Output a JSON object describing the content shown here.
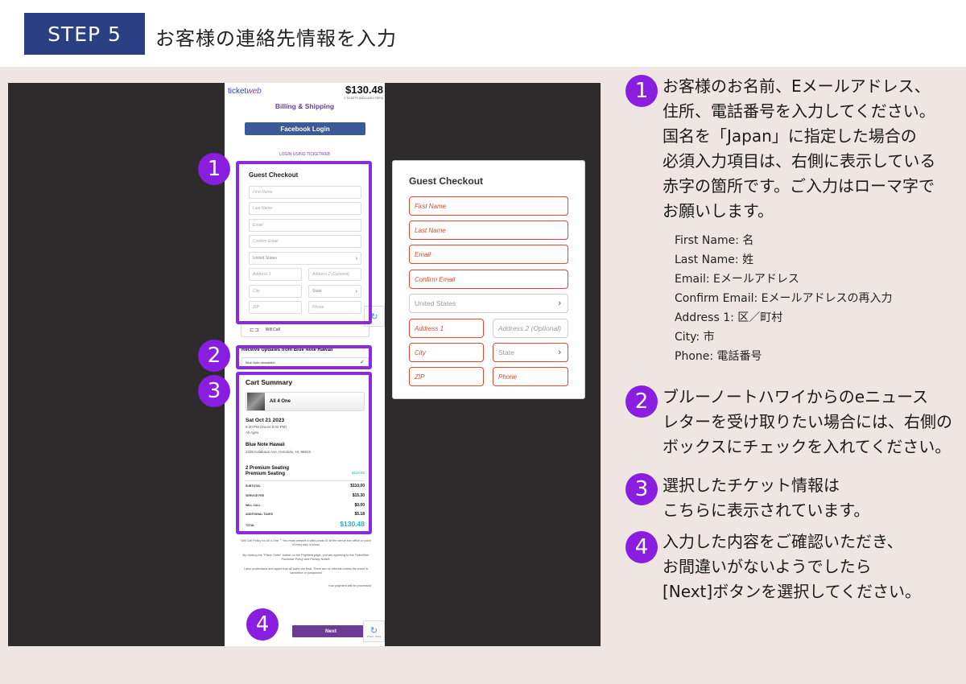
{
  "header": {
    "step": "STEP 5",
    "title": "お客様の連絡先情報を入力"
  },
  "phone": {
    "logo_a": "ticket",
    "logo_b": "web",
    "total": "$130.48",
    "total_sub": "2 TICKETS (INCLUDES FEES)",
    "billing_title": "Billing & Shipping",
    "facebook_label": "Facebook Login",
    "login_ticketweb": "LOGIN USING TICKETWEB",
    "guest_checkout": "Guest Checkout",
    "fields": {
      "first_name": "First Name",
      "last_name": "Last Name",
      "email": "Email",
      "confirm_email": "Confirm Email",
      "country": "United States",
      "address1": "Address 1",
      "address2": "Address 2 (Optional)",
      "city": "City",
      "state": "State",
      "zip": "ZIP",
      "phone": "Phone"
    },
    "will_call": "Will Call",
    "updates_title": "Receive Updates from Blue Note Hawaii",
    "newsletter": "Blue Note newsletter",
    "cart": {
      "title": "Cart Summary",
      "event": "All 4 One",
      "date": "Sat Oct 21 2023",
      "time": "6:30 PM (Doors 5:00 PM)",
      "ages": "All Ages",
      "venue": "Blue Note Hawaii",
      "address": "2335 Kalakaua Ave, Honolulu, HI, 96815",
      "seat_line1": "2 Premium Seating",
      "seat_line2": "Premium Seating",
      "seat_price": "$110.00",
      "rows": [
        {
          "k": "SUBTOTAL",
          "v": "$110.00"
        },
        {
          "k": "SERVICE FEE",
          "v": "$15.30"
        },
        {
          "k": "WILL CALL",
          "v": "$0.00"
        },
        {
          "k": "ADDITIONAL TAXES",
          "v": "$5.18"
        },
        {
          "k": "TOTAL",
          "v": "$130.48"
        }
      ]
    },
    "policy1": "Will Call Policy for All 4 One \"\" You must present a valid photo ID at the venue box office or point of entry day of show.",
    "policy2": "By clicking the \"Place Order\" button on the Payment page, you are agreeing to the TicketWeb Purchase Policy and Privacy Notice.",
    "policy3": "I also understand and agree that all sales are final. There are no refunds unless the event is cancelled or postponed",
    "policy4": "Your payment will be processed",
    "next": "Next",
    "recaptcha_text": "Privacy - Terms"
  },
  "callouts": [
    "1",
    "2",
    "3",
    "4"
  ],
  "card": {
    "title": "Guest Checkout",
    "first_name": "First Name",
    "last_name": "Last Name",
    "email": "Email",
    "confirm_email": "Confirm Email",
    "country": "United States",
    "address1": "Address 1",
    "address2": "Address 2 (Optional)",
    "city": "City",
    "state": "State",
    "zip": "ZIP",
    "phone": "Phone"
  },
  "instructions": {
    "i1": [
      "お客様のお名前、Eメールアドレス、",
      "住所、電話番号を入力してください。",
      "国名を「Japan」に指定した場合の",
      "必須入力項目は、右側に表示している",
      "赤字の箇所です。ご入力はローマ字で",
      "お願いします。"
    ],
    "fields": [
      "First Name: 名",
      "Last Name: 姓",
      "Email: Eメールアドレス",
      "Confirm Email: Eメールアドレスの再入力",
      "Address 1: 区／町村",
      "City: 市",
      "Phone: 電話番号"
    ],
    "i2": [
      "ブルーノートハワイからのeニュース",
      "レターを受け取りたい場合には、右側の",
      "ボックスにチェックを入れてください。"
    ],
    "i3": [
      "選択したチケット情報は",
      "こちらに表示されています。"
    ],
    "i4": [
      "入力した内容をご確認いただき、",
      "お間違いがないようでしたら",
      "[Next]ボタンを選択してください。"
    ]
  },
  "colors": {
    "accent": "#8a1ee0",
    "header_badge": "#2b3f84",
    "required_red": "#e5472f",
    "brand_purple": "#6a3c96"
  }
}
